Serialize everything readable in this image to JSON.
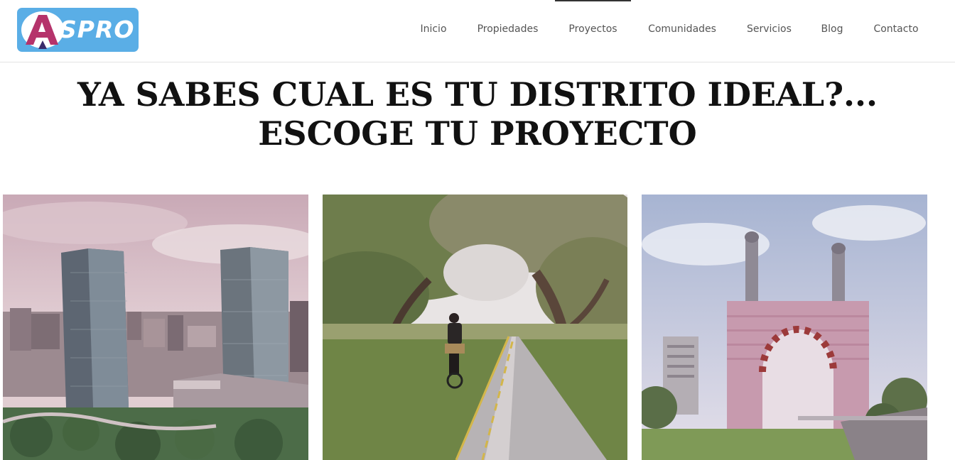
{
  "brand": {
    "logo_text": "SPRO",
    "logo_letter": "A",
    "logo_mark": "®"
  },
  "nav": {
    "items": [
      {
        "label": "Inicio"
      },
      {
        "label": "Propiedades"
      },
      {
        "label": "Proyectos",
        "active": true
      },
      {
        "label": "Comunidades"
      },
      {
        "label": "Servicios"
      },
      {
        "label": "Blog"
      },
      {
        "label": "Contacto"
      }
    ]
  },
  "hero": {
    "line1": "YA SABES CUAL ES TU DISTRITO IDEAL?...",
    "line2": "ESCOGE TU PROYECTO"
  },
  "cards": [
    {
      "image": "city-towers-photo"
    },
    {
      "image": "park-cyclist-photo"
    },
    {
      "image": "moorish-arch-photo"
    }
  ],
  "colors": {
    "logo_bg": "#5aaee6",
    "logo_accent": "#b5336b",
    "nav_text": "#555555",
    "headline": "#111111"
  }
}
